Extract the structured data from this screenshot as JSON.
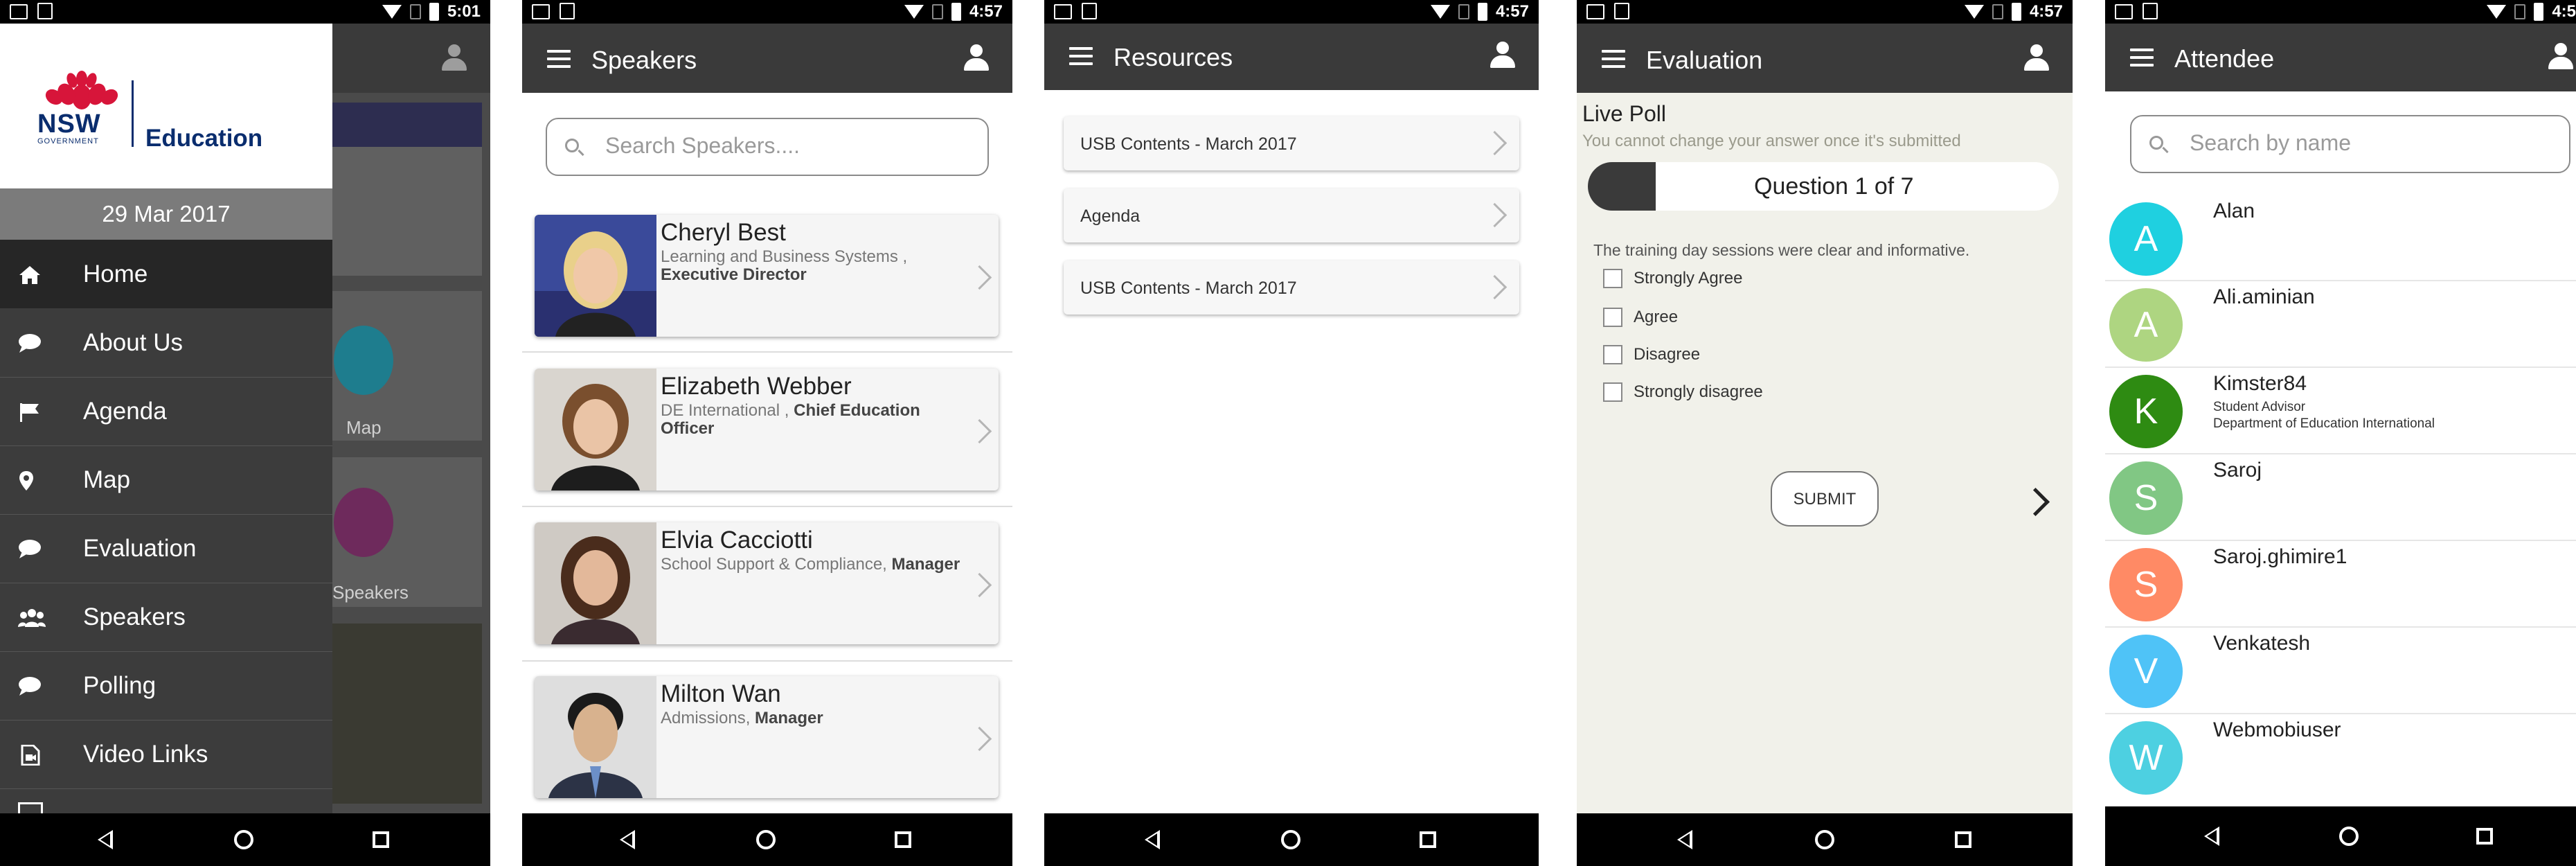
{
  "colors": {
    "appbar": "#3a3a3a",
    "drawer": "#3c3c3c",
    "nsw_blue": "#0a2d6e",
    "nsw_red": "#d7153a"
  },
  "status_times": [
    "5:01",
    "4:57",
    "4:57",
    "4:57",
    "4:5"
  ],
  "drawer": {
    "logo_nsw": "NSW",
    "logo_gov": "GOVERNMENT",
    "logo_education": "Education",
    "date": "29 Mar 2017",
    "items": [
      {
        "label": "Home",
        "icon": "home-icon"
      },
      {
        "label": "About Us",
        "icon": "chat-bubble-icon"
      },
      {
        "label": "Agenda",
        "icon": "flag-icon"
      },
      {
        "label": "Map",
        "icon": "map-pin-icon"
      },
      {
        "label": "Evaluation",
        "icon": "chat-bubble-icon"
      },
      {
        "label": "Speakers",
        "icon": "group-icon"
      },
      {
        "label": "Polling",
        "icon": "chat-bubble-icon"
      },
      {
        "label": "Video Links",
        "icon": "video-file-icon"
      }
    ],
    "background_labels": [
      "Map",
      "Speakers"
    ]
  },
  "speakers": {
    "title": "Speakers",
    "search_placeholder": "Search Speakers....",
    "items": [
      {
        "name": "Cheryl Best",
        "org": "Learning and Business Systems ,",
        "role": "Executive Director"
      },
      {
        "name": "Elizabeth Webber",
        "org": "DE International ,",
        "role": "Chief Education Officer"
      },
      {
        "name": "Elvia Cacciotti",
        "org": "School Support & Compliance,",
        "role": "Manager"
      },
      {
        "name": "Milton Wan",
        "org": "Admissions,",
        "role": "Manager"
      }
    ]
  },
  "resources": {
    "title": "Resources",
    "items": [
      "USB Contents - March 2017",
      "Agenda",
      "USB Contents - March 2017"
    ]
  },
  "evaluation": {
    "title": "Evaluation",
    "heading": "Live Poll",
    "note": "You cannot change your answer once it's submitted",
    "question_counter": "Question 1 of 7",
    "question": "The training day sessions were clear and informative.",
    "options": [
      "Strongly Agree",
      "Agree",
      "Disagree",
      "Strongly disagree"
    ],
    "submit_label": "SUBMIT"
  },
  "attendee": {
    "title": "Attendee",
    "search_placeholder": "Search by name",
    "items": [
      {
        "initial": "A",
        "name": "Alan",
        "color": "#1fd0e0",
        "line1": "",
        "line2": ""
      },
      {
        "initial": "A",
        "name": "Ali.aminian",
        "color": "#aed581",
        "line1": "",
        "line2": ""
      },
      {
        "initial": "K",
        "name": "Kimster84",
        "color": "#2e8b12",
        "line1": "Student Advisor",
        "line2": "Department of Education International"
      },
      {
        "initial": "S",
        "name": "Saroj",
        "color": "#81c784",
        "line1": "",
        "line2": ""
      },
      {
        "initial": "S",
        "name": "Saroj.ghimire1",
        "color": "#ff8a65",
        "line1": "",
        "line2": ""
      },
      {
        "initial": "V",
        "name": "Venkatesh",
        "color": "#4fc3f7",
        "line1": "",
        "line2": ""
      },
      {
        "initial": "W",
        "name": "Webmobiuser",
        "color": "#4dd0e1",
        "line1": "",
        "line2": ""
      }
    ]
  }
}
